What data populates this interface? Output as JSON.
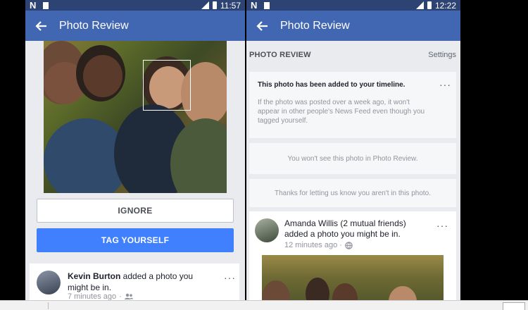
{
  "left_screen": {
    "statusbar": {
      "carrier_glyph": "N",
      "time": "11:57"
    },
    "appbar": {
      "title": "Photo Review"
    },
    "buttons": {
      "ignore": "IGNORE",
      "tag_yourself": "TAG YOURSELF"
    },
    "feed_post": {
      "author": "Kevin Burton",
      "action": " added a photo you might be in.",
      "time": "7 minutes ago",
      "more": "···"
    }
  },
  "right_screen": {
    "statusbar": {
      "carrier_glyph": "N",
      "time": "12:22"
    },
    "appbar": {
      "title": "Photo Review"
    },
    "section": {
      "title": "PHOTO REVIEW",
      "settings": "Settings"
    },
    "notice_timeline": {
      "title": "This photo has been added to your timeline.",
      "body": "If the photo was posted over a week ago, it won't appear in other people's News Feed even though you tagged yourself.",
      "more": "···"
    },
    "notice_hidden": "You won't see this photo in Photo Review.",
    "notice_thanks": "Thanks for letting us know you aren't in this photo.",
    "feed_post": {
      "author": "Amanda Willis",
      "friends": " (2 mutual friends)",
      "action": "added a photo you might be in.",
      "time": "12 minutes ago ·",
      "more": "···"
    }
  },
  "colors": {
    "facebook_blue": "#4267b2",
    "button_blue": "#4080ff",
    "statusbar": "#2d4373"
  },
  "icons": [
    "back-arrow-icon",
    "signal-icon",
    "battery-icon",
    "more-icon",
    "friends-icon",
    "globe-icon"
  ]
}
